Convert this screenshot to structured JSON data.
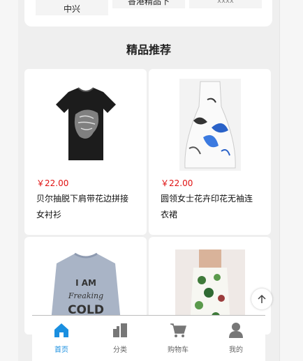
{
  "categories": {
    "chips": [
      "中兴",
      "香港精品下",
      "xxxx"
    ]
  },
  "recommend": {
    "title": "精品推荐",
    "products": [
      {
        "price": "￥22.00",
        "name": "贝尔抽脱下肩带花边拼接女衬衫",
        "image": "black-lion-tshirt"
      },
      {
        "price": "￥22.00",
        "name": "圆领女士花卉印花无袖连衣裙",
        "image": "butterfly-print-dress"
      },
      {
        "price": "",
        "name": "",
        "image": "gray-i-am-freaking-cold-sweatshirt",
        "print_text": [
          "I AM",
          "Freaking",
          "COLD"
        ]
      },
      {
        "price": "",
        "name": "",
        "image": "floral-strapless-dress"
      }
    ]
  },
  "tabbar": {
    "items": [
      {
        "label": "首页",
        "icon": "home-icon",
        "active": true
      },
      {
        "label": "分类",
        "icon": "category-icon",
        "active": false
      },
      {
        "label": "购物车",
        "icon": "cart-icon",
        "active": false
      },
      {
        "label": "我的",
        "icon": "user-icon",
        "active": false
      }
    ]
  },
  "colors": {
    "accent": "#1a8fe0",
    "price": "#e01010",
    "icon_gray": "#777777"
  }
}
